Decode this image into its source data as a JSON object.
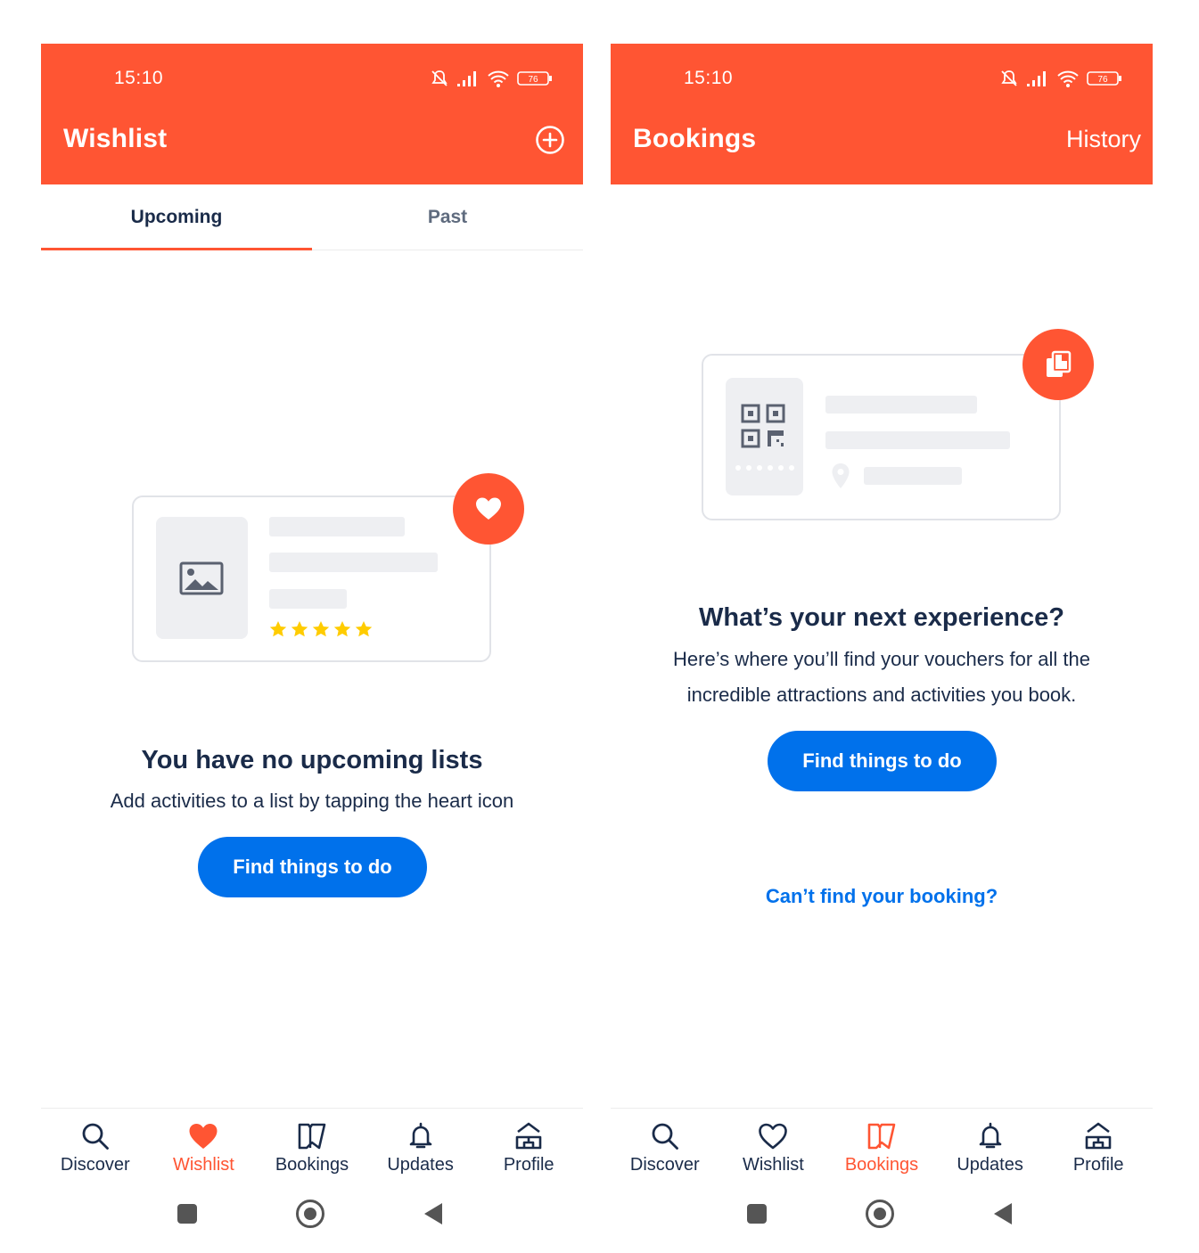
{
  "wishlist_screen": {
    "status_bar": {
      "time": "15:10",
      "battery": "76"
    },
    "app_bar": {
      "title": "Wishlist",
      "add_icon": "plus-circle-icon"
    },
    "tabs": [
      {
        "label": "Upcoming",
        "selected": true
      },
      {
        "label": "Past",
        "selected": false
      }
    ],
    "empty_state": {
      "illustration_icon": "heart-icon",
      "rating_stars": 5,
      "title": "You have no upcoming lists",
      "message": "Add activities to a list by tapping the heart icon",
      "button_label": "Find things to do"
    },
    "bottom_nav": [
      {
        "label": "Discover",
        "icon": "search-icon",
        "active": false
      },
      {
        "label": "Wishlist",
        "icon": "heart-icon",
        "active": true
      },
      {
        "label": "Bookings",
        "icon": "bookings-icon",
        "active": false
      },
      {
        "label": "Updates",
        "icon": "bell-icon",
        "active": false
      },
      {
        "label": "Profile",
        "icon": "profile-icon",
        "active": false
      }
    ]
  },
  "bookings_screen": {
    "status_bar": {
      "time": "15:10",
      "battery": "76"
    },
    "app_bar": {
      "title": "Bookings",
      "history_label": "History"
    },
    "empty_state": {
      "illustration_icon": "voucher-icon",
      "title": "What’s your next experience?",
      "message_line1": "Here’s where you’ll find your vouchers for all the",
      "message_line2": "incredible attractions and activities you book.",
      "button_label": "Find things to do",
      "help_link": "Can’t find your booking?"
    },
    "bottom_nav": [
      {
        "label": "Discover",
        "icon": "search-icon",
        "active": false
      },
      {
        "label": "Wishlist",
        "icon": "heart-outline-icon",
        "active": false
      },
      {
        "label": "Bookings",
        "icon": "bookings-icon",
        "active": true
      },
      {
        "label": "Updates",
        "icon": "bell-icon",
        "active": false
      },
      {
        "label": "Profile",
        "icon": "profile-icon",
        "active": false
      }
    ]
  },
  "colors": {
    "brand": "#ff5533",
    "primary_button": "#0071eb",
    "text": "#1a2b49",
    "star": "#ffcc00"
  }
}
